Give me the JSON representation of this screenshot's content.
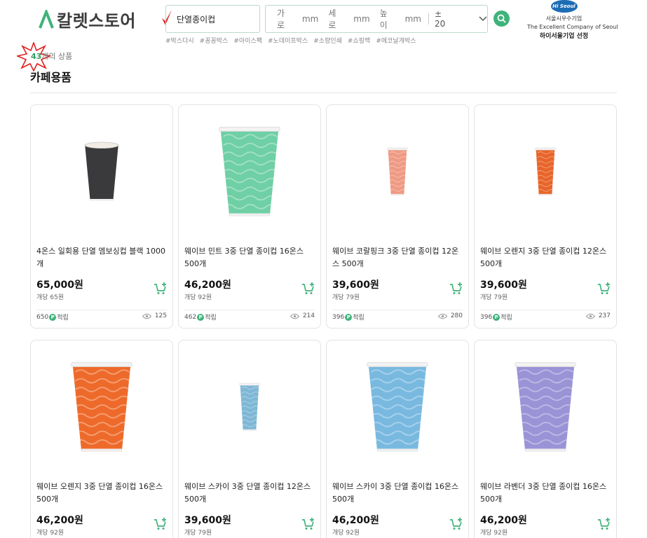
{
  "header": {
    "logo_text": "칼렛스토어",
    "search_value": "단열종이컵",
    "dims": [
      {
        "label": "가로",
        "unit": "mm"
      },
      {
        "label": "세로",
        "unit": "mm"
      },
      {
        "label": "높이",
        "unit": "mm"
      }
    ],
    "tolerance": "± 20",
    "hashtags": [
      "#박스다시",
      "#꽁꽁박스",
      "#아이스팩",
      "#노데이프박스",
      "#소량인쇄",
      "#쇼핑백",
      "#에코날개박스"
    ],
    "badge": {
      "logo": "Hi Seoul",
      "line1": "서울시우수기업",
      "line2": "The Excellent Company of Seoul",
      "line3": "하이서울기업 선정"
    }
  },
  "listing": {
    "count": "43",
    "count_suffix": "개의 상품",
    "category_title": "카페용품"
  },
  "products": [
    {
      "name": "4온스 일회용 단열 엠보싱컵 블랙 1000개",
      "price": "65,000원",
      "unit_price": "개당 65원",
      "points": "650",
      "points_label": "적립",
      "views": "125",
      "cup_color": "#3a3a3d",
      "cup_style": "small-black"
    },
    {
      "name": "웨이브 민트 3중 단열 종이컵 16온스 500개",
      "price": "46,200원",
      "unit_price": "개당 92원",
      "points": "462",
      "points_label": "적립",
      "views": "214",
      "cup_color": "#6fcfa5",
      "cup_style": "tall"
    },
    {
      "name": "웨이브 코랄핑크 3중 단열 종이컵 12온스 500개",
      "price": "39,600원",
      "unit_price": "개당 79원",
      "points": "396",
      "points_label": "적립",
      "views": "280",
      "cup_color": "#ef9a84",
      "cup_style": "small"
    },
    {
      "name": "웨이브 오렌지 3중 단열 종이컵 12온스 500개",
      "price": "39,600원",
      "unit_price": "개당 79원",
      "points": "396",
      "points_label": "적립",
      "views": "237",
      "cup_color": "#e8652a",
      "cup_style": "small"
    },
    {
      "name": "웨이브 오렌지 3중 단열 종이컵 16온스 500개",
      "price": "46,200원",
      "unit_price": "개당 92원",
      "points": "",
      "points_label": "",
      "views": "",
      "cup_color": "#ee6a2a",
      "cup_style": "tall"
    },
    {
      "name": "웨이브 스카이 3중 단열 종이컵 12온스 500개",
      "price": "39,600원",
      "unit_price": "개당 79원",
      "points": "",
      "points_label": "",
      "views": "",
      "cup_color": "#7fb7d6",
      "cup_style": "small"
    },
    {
      "name": "웨이브 스카이 3중 단열 종이컵 16온스 500개",
      "price": "46,200원",
      "unit_price": "개당 92원",
      "points": "",
      "points_label": "",
      "views": "",
      "cup_color": "#79b9e0",
      "cup_style": "tall"
    },
    {
      "name": "웨이브 라벤더 3중 단열 종이컵 16온스 500개",
      "price": "46,200원",
      "unit_price": "개당 92원",
      "points": "",
      "points_label": "",
      "views": "",
      "cup_color": "#9a93d6",
      "cup_style": "tall"
    }
  ],
  "icons": {
    "logo": "arrow-logo-icon",
    "search": "search-icon",
    "chevron": "chevron-down-icon",
    "cart": "add-to-cart-icon",
    "eye": "eye-icon",
    "points": "points-badge-icon"
  },
  "colors": {
    "accent": "#3fb37a",
    "count": "#2e9e62"
  }
}
